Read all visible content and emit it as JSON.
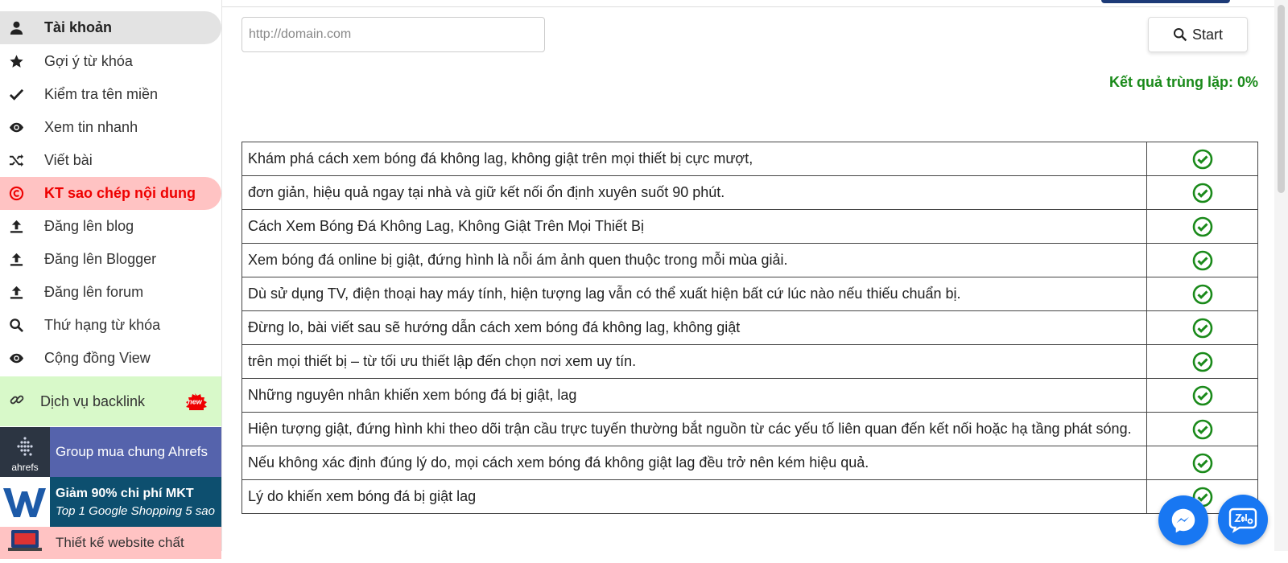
{
  "sidebar": {
    "items": [
      {
        "label": "Tài khoản",
        "icon": "user-icon",
        "state": "active"
      },
      {
        "label": "Gợi ý từ khóa",
        "icon": "star-icon"
      },
      {
        "label": "Kiểm tra tên miền",
        "icon": "check-icon"
      },
      {
        "label": "Xem tin nhanh",
        "icon": "eye-icon"
      },
      {
        "label": "Viết bài",
        "icon": "shuffle-icon"
      },
      {
        "label": "KT sao chép nội dung",
        "icon": "copyright-icon",
        "state": "alert"
      },
      {
        "label": "Đăng lên blog",
        "icon": "upload-icon"
      },
      {
        "label": "Đăng lên Blogger",
        "icon": "upload-icon"
      },
      {
        "label": "Đăng lên forum",
        "icon": "upload-icon"
      },
      {
        "label": "Thứ hạng từ khóa",
        "icon": "search-icon"
      },
      {
        "label": "Cộng đồng View",
        "icon": "eye-icon"
      }
    ],
    "backlink": {
      "label": "Dịch vụ backlink",
      "badge": "new"
    },
    "promos": [
      {
        "label": "Group mua chung Ahrefs",
        "logo_text": "ahrefs"
      },
      {
        "title": "Giảm 90% chi phí MKT",
        "subtitle": "Top 1 Google Shopping 5 sao"
      },
      {
        "label": "Thiết kế website chất"
      }
    ]
  },
  "search": {
    "placeholder": "http://domain.com",
    "value": ""
  },
  "start_button": {
    "label": "Start"
  },
  "result": {
    "text": "Kết quả trùng lặp: 0%"
  },
  "rows": [
    "Khám phá cách xem bóng đá không lag, không giật trên mọi thiết bị cực mượt,",
    "đơn giản, hiệu quả ngay tại nhà và giữ kết nối ổn định xuyên suốt 90 phút.",
    "Cách Xem Bóng Đá Không Lag, Không Giật Trên Mọi Thiết Bị",
    "Xem bóng đá online bị giật, đứng hình là nỗi ám ảnh quen thuộc trong mỗi mùa giải.",
    "Dù sử dụng TV, điện thoại hay máy tính, hiện tượng lag vẫn có thể xuất hiện bất cứ lúc nào nếu thiếu chuẩn bị.",
    "Đừng lo, bài viết sau sẽ hướng dẫn cách xem bóng đá không lag, không giật",
    "trên mọi thiết bị – từ tối ưu thiết lập đến chọn nơi xem uy tín.",
    "Những nguyên nhân khiến xem bóng đá bị giật, lag",
    "Hiện tượng giật, đứng hình khi theo dõi trận cầu trực tuyến thường bắt nguồn từ các yếu tố liên quan đến kết nối hoặc hạ tầng phát sóng.",
    "Nếu không xác định đúng lý do, mọi cách xem bóng đá không giật lag đều trở nên kém hiệu quả.",
    "Lý do khiến xem bóng đá bị giật lag"
  ],
  "colors": {
    "check": "#1a8a1a",
    "alert_bg": "#ffc3c3",
    "alert_text": "#e00000",
    "result_text": "#1a8a1a",
    "fab": "#1877f2"
  }
}
